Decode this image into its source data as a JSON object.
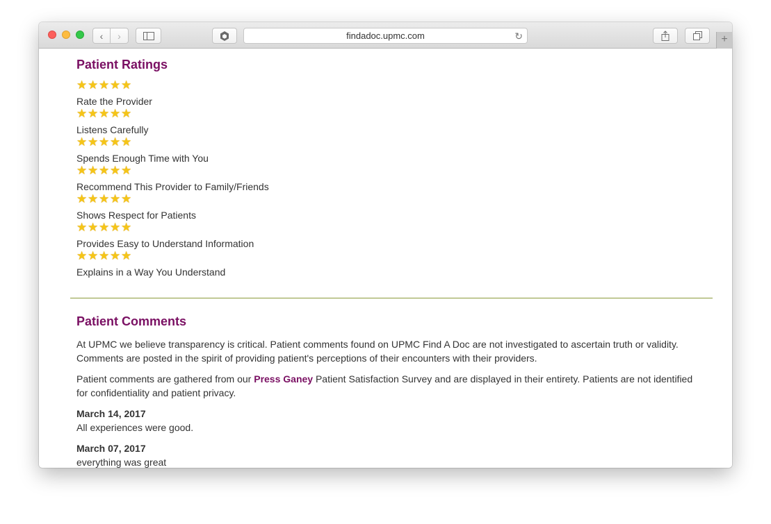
{
  "browser": {
    "url": "findadoc.upmc.com",
    "back_icon": "chevron-left-icon",
    "forward_icon": "chevron-right-icon",
    "sidebar_icon": "sidebar-icon",
    "extension_icon": "hexagon-icon",
    "reload_icon": "reload-icon",
    "share_icon": "share-icon",
    "tabs_icon": "tabs-icon",
    "new_tab_label": "+"
  },
  "ratings": {
    "title": "Patient Ratings",
    "items": [
      {
        "label": "Rate the Provider",
        "stars": 5
      },
      {
        "label": "Listens Carefully",
        "stars": 5
      },
      {
        "label": "Spends Enough Time with You",
        "stars": 5
      },
      {
        "label": "Recommend This Provider to Family/Friends",
        "stars": 5
      },
      {
        "label": "Shows Respect for Patients",
        "stars": 5
      },
      {
        "label": "Provides Easy to Understand Information",
        "stars": 5
      },
      {
        "label": "Explains in a Way You Understand",
        "stars": 5
      }
    ]
  },
  "comments": {
    "title": "Patient Comments",
    "intro": "At UPMC we believe transparency is critical. Patient comments found on UPMC Find A Doc are not investigated to ascertain truth or validity. Comments are posted in the spirit of providing patient's perceptions of their encounters with their providers.",
    "source_before": "Patient comments are gathered from our ",
    "source_link": "Press Ganey",
    "source_after": " Patient Satisfaction Survey and are displayed in their entirety. Patients are not identified for confidentiality and patient privacy.",
    "entries": [
      {
        "date": "March 14, 2017",
        "text": "All experiences were good."
      },
      {
        "date": "March 07, 2017",
        "text": "everything was great"
      }
    ]
  },
  "colors": {
    "heading": "#7a1063",
    "link": "#7a1063",
    "star": "#f5c518",
    "divider": "#8a9a3a"
  }
}
